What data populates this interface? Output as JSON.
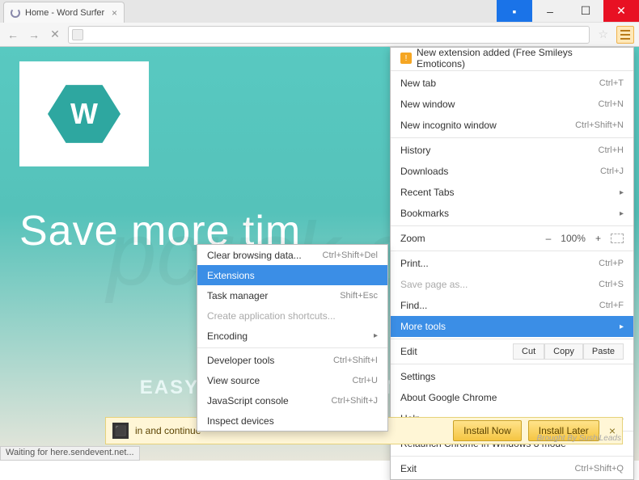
{
  "titlebar": {
    "win_min": "–",
    "win_max": "☐",
    "win_close": "✕",
    "user": "👤"
  },
  "tab": {
    "title": "Home - Word Surfer",
    "close": "×"
  },
  "page": {
    "logo_letter": "W",
    "headline": "Save more tim",
    "sub": "EASY AS HIGHLIGHT AND CLICK!"
  },
  "menu": {
    "ext_alert": "New extension added (Free Smileys  Emoticons)",
    "new_tab": "New tab",
    "new_tab_kbd": "Ctrl+T",
    "new_window": "New window",
    "new_window_kbd": "Ctrl+N",
    "new_incognito": "New incognito window",
    "new_incognito_kbd": "Ctrl+Shift+N",
    "history": "History",
    "history_kbd": "Ctrl+H",
    "downloads": "Downloads",
    "downloads_kbd": "Ctrl+J",
    "recent_tabs": "Recent Tabs",
    "bookmarks": "Bookmarks",
    "zoom": "Zoom",
    "zoom_val": "100%",
    "print": "Print...",
    "print_kbd": "Ctrl+P",
    "save_as": "Save page as...",
    "save_as_kbd": "Ctrl+S",
    "find": "Find...",
    "find_kbd": "Ctrl+F",
    "more_tools": "More tools",
    "edit": "Edit",
    "cut": "Cut",
    "copy": "Copy",
    "paste": "Paste",
    "settings": "Settings",
    "about": "About Google Chrome",
    "help": "Help",
    "relaunch": "Relaunch Chrome in Windows 8 mode",
    "exit": "Exit",
    "exit_kbd": "Ctrl+Shift+Q"
  },
  "submenu": {
    "clear": "Clear browsing data...",
    "clear_kbd": "Ctrl+Shift+Del",
    "extensions": "Extensions",
    "task_mgr": "Task manager",
    "task_mgr_kbd": "Shift+Esc",
    "shortcuts": "Create application shortcuts...",
    "encoding": "Encoding",
    "devtools": "Developer tools",
    "devtools_kbd": "Ctrl+Shift+I",
    "view_src": "View source",
    "view_src_kbd": "Ctrl+U",
    "js_console": "JavaScript console",
    "js_console_kbd": "Ctrl+Shift+J",
    "inspect": "Inspect devices"
  },
  "install": {
    "text": "in and continue",
    "now": "Install Now",
    "later": "Install Later",
    "brought": "Brought By SushiLeads"
  },
  "status": "Waiting for here.sendevent.net..."
}
